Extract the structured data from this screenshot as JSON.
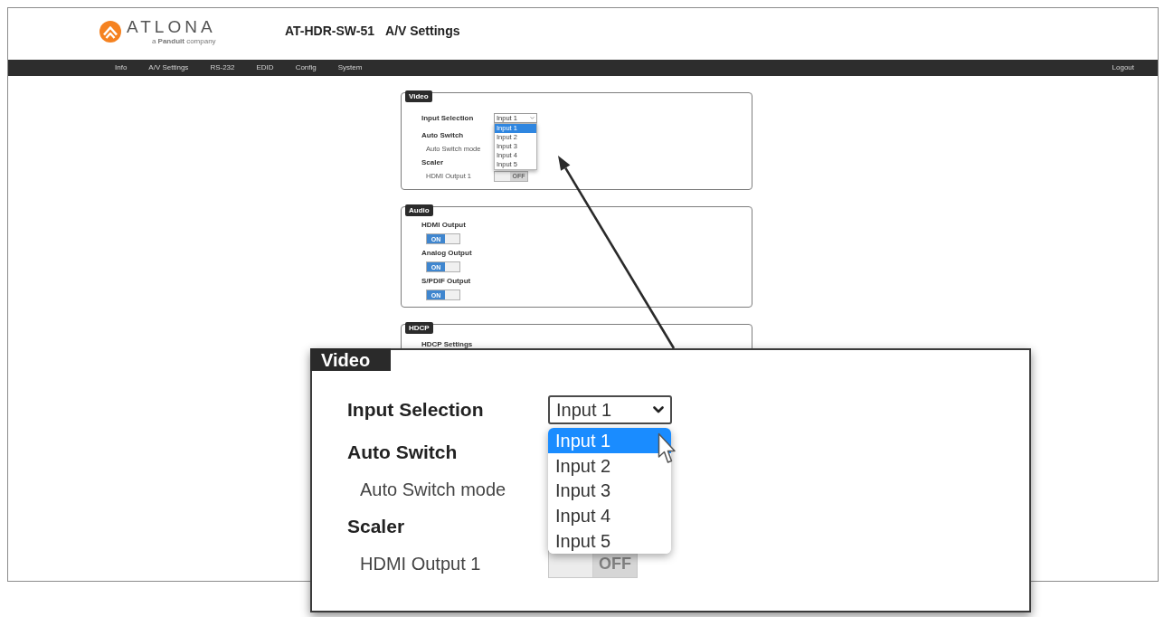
{
  "header": {
    "logo": {
      "wordmark": "ATLONA",
      "tagline": "a **Panduit** company"
    },
    "model": "AT-HDR-SW-51",
    "page_title": "A/V Settings"
  },
  "nav": {
    "items": [
      "Info",
      "A/V Settings",
      "RS-232",
      "EDID",
      "Config",
      "System"
    ],
    "logout": "Logout"
  },
  "panels": [
    {
      "legend": "Video",
      "rows": [
        {
          "kind": "select",
          "label": "Input Selection",
          "value": "Input 1",
          "expanded": true,
          "options": [
            {
              "label": "Input 1",
              "selected": true
            },
            {
              "label": "Input 2",
              "selected": false
            },
            {
              "label": "Input 3",
              "selected": false
            },
            {
              "label": "Input 4",
              "selected": false
            },
            {
              "label": "Input 5",
              "selected": false
            }
          ]
        },
        {
          "kind": "heading",
          "label": "Auto Switch"
        },
        {
          "kind": "setting",
          "label": "Auto Switch mode"
        },
        {
          "kind": "heading",
          "label": "Scaler"
        },
        {
          "kind": "toggle",
          "label": "HDMI Output 1",
          "on": false,
          "text": "OFF"
        }
      ]
    },
    {
      "legend": "Audio",
      "rows": [
        {
          "kind": "switch",
          "label": "HDMI Output",
          "on": true,
          "text": "ON"
        },
        {
          "kind": "switch",
          "label": "Analog Output",
          "on": true,
          "text": "ON"
        },
        {
          "kind": "switch",
          "label": "S/PDIF Output",
          "on": true,
          "text": "ON"
        }
      ]
    },
    {
      "legend": "HDCP",
      "rows": [
        {
          "kind": "heading",
          "label": "HDCP Settings"
        }
      ]
    }
  ],
  "callout": {
    "legend": "Video",
    "rows": [
      {
        "kind": "select",
        "label": "Input Selection",
        "value": "Input 1",
        "expanded": true,
        "options": [
          {
            "label": "Input 1",
            "selected": true
          },
          {
            "label": "Input 2",
            "selected": false
          },
          {
            "label": "Input 3",
            "selected": false
          },
          {
            "label": "Input 4",
            "selected": false
          },
          {
            "label": "Input 5",
            "selected": false
          }
        ]
      },
      {
        "kind": "heading",
        "label": "Auto Switch"
      },
      {
        "kind": "setting",
        "label": "Auto Switch mode"
      },
      {
        "kind": "heading",
        "label": "Scaler"
      },
      {
        "kind": "toggle",
        "label": "HDMI Output 1",
        "on": false,
        "text": "OFF"
      }
    ]
  }
}
